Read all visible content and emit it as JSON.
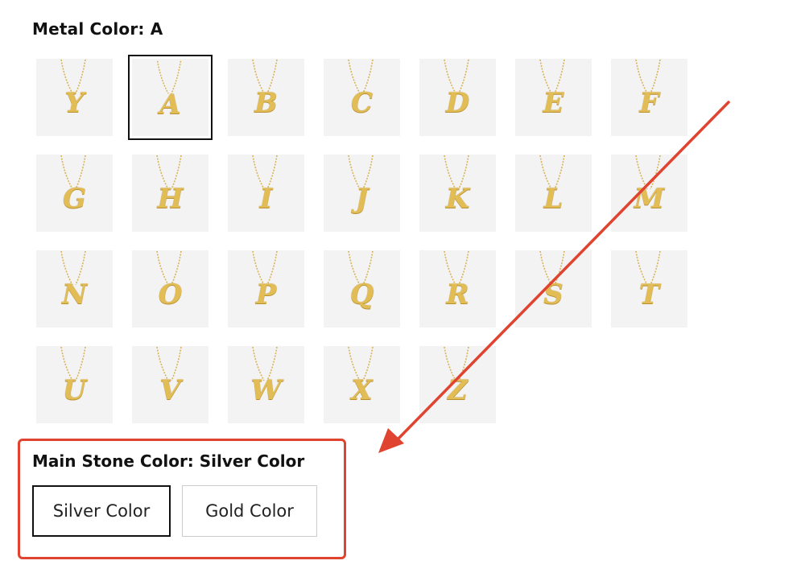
{
  "metal_color": {
    "label": "Metal Color: A"
  },
  "letters": [
    "Y",
    "A",
    "B",
    "C",
    "D",
    "E",
    "F",
    "G",
    "H",
    "I",
    "J",
    "K",
    "L",
    "M",
    "N",
    "O",
    "P",
    "Q",
    "R",
    "S",
    "T",
    "U",
    "V",
    "W",
    "X",
    "Z"
  ],
  "selected_letter": "A",
  "main_stone": {
    "label": "Main Stone Color: Silver Color",
    "options": [
      "Silver Color",
      "Gold Color"
    ],
    "selected": "Silver Color"
  },
  "colors": {
    "annotation_red": "#e0432f",
    "gold": "#e2bd55",
    "tile_bg": "#f3f3f3"
  }
}
